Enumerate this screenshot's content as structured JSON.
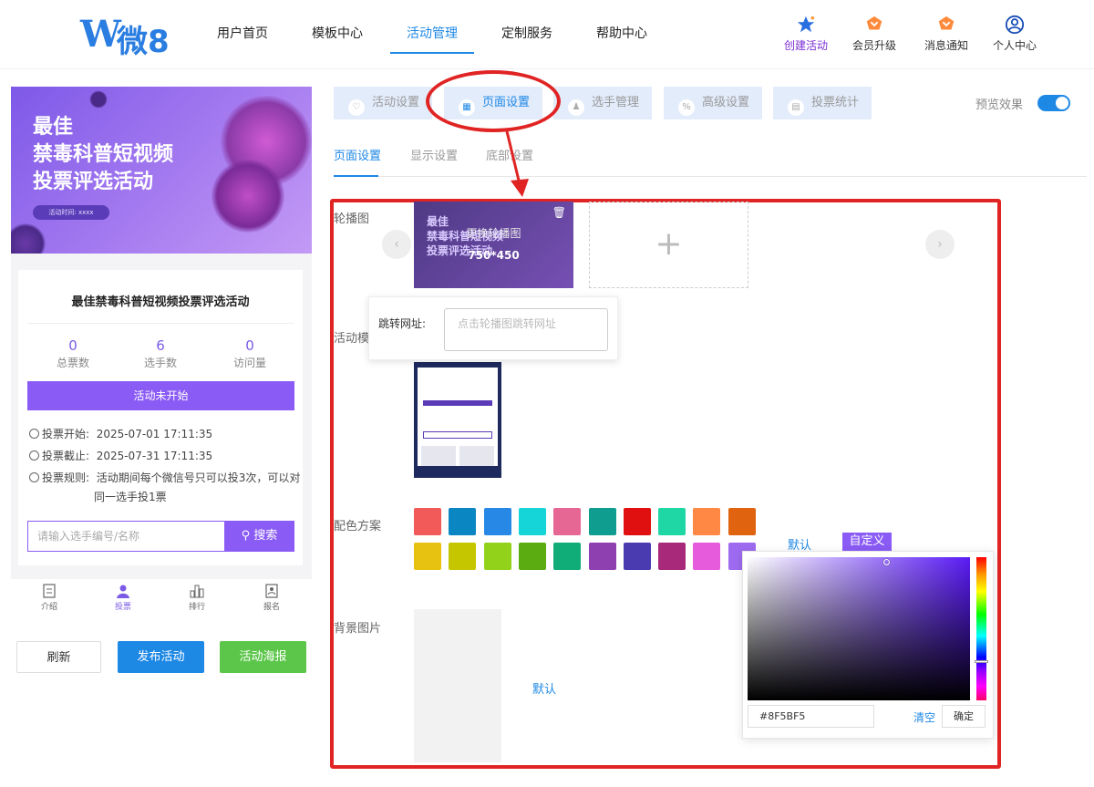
{
  "header": {
    "logo_letter": "W",
    "logo_text": "微8",
    "nav": [
      "用户首页",
      "模板中心",
      "活动管理",
      "定制服务",
      "帮助中心"
    ],
    "active_nav": "活动管理",
    "actions": [
      {
        "label": "创建活动",
        "icon": "star-icon",
        "color": "#7b2fd6"
      },
      {
        "label": "会员升级",
        "icon": "crown-icon",
        "color": "#333333"
      },
      {
        "label": "消息通知",
        "icon": "bell-icon",
        "color": "#333333"
      },
      {
        "label": "个人中心",
        "icon": "user-icon",
        "color": "#333333"
      }
    ]
  },
  "preview": {
    "banner_title_lines": [
      "最佳",
      "禁毒科普短视频",
      "投票评选活动"
    ],
    "banner_time": "活动时间: xxxx",
    "activity_name": "最佳禁毒科普短视频投票评选活动",
    "stats": [
      {
        "value": "0",
        "label": "总票数"
      },
      {
        "value": "6",
        "label": "选手数"
      },
      {
        "value": "0",
        "label": "访问量"
      }
    ],
    "status": "活动未开始",
    "vote_start": "投票开始:",
    "vote_start_value": "2025-07-01 17:11:35",
    "vote_end": "投票截止:",
    "vote_end_value": "2025-07-31 17:11:35",
    "vote_rule": "投票规则:",
    "vote_rule_value_1": "活动期间每个微信号只可以投3次，可以对",
    "vote_rule_value_2": "同一选手投1票",
    "search_placeholder": "请输入选手编号/名称",
    "search_button": "搜索",
    "tabbar": [
      "介绍",
      "投票",
      "排行",
      "报名"
    ],
    "active_tab": "投票",
    "buttons": {
      "refresh": "刷新",
      "publish": "发布活动",
      "poster": "活动海报"
    }
  },
  "settings": {
    "top_tabs": [
      "活动设置",
      "页面设置",
      "选手管理",
      "高级设置",
      "投票统计"
    ],
    "active_top_tab": "页面设置",
    "preview_toggle_label": "预览效果",
    "preview_toggle_on": true,
    "sub_tabs": [
      "页面设置",
      "显示设置",
      "底部设置"
    ],
    "active_sub_tab": "页面设置",
    "labels": {
      "carousel": "轮播图",
      "template": "活动模",
      "color_scheme": "配色方案",
      "bg_image": "背景图片"
    },
    "carousel": {
      "image_title_lines": [
        "最佳",
        "禁毒科普短视频",
        "投票评选活动"
      ],
      "replace_hint": "更换轮播图",
      "size": "750*450",
      "add_symbol": "+"
    },
    "jump_url": {
      "label": "跳转网址:",
      "placeholder": "点击轮播图跳转网址"
    },
    "swatches_row1": [
      "#f25a5a",
      "#0a86c2",
      "#2788e6",
      "#15d5d8",
      "#e66694",
      "#0e9d8f",
      "#e01010",
      "#1fd6a5",
      "#ff8844",
      "#e06410"
    ],
    "swatches_row2": [
      "#e8c210",
      "#c6c600",
      "#92d21a",
      "#5bac10",
      "#10ad78",
      "#8e3fb0",
      "#4a3bb0",
      "#a8287a",
      "#e65adc",
      "#9e6bf0"
    ],
    "color_default": "默认",
    "color_custom": "自定义",
    "bg_default": "默认",
    "picker": {
      "hex": "#8F5BF5",
      "clear": "清空",
      "confirm": "确定"
    }
  },
  "colors": {
    "brand": "#1e88e5",
    "accent": "#8a5bf5",
    "annotation": "#e02424"
  }
}
